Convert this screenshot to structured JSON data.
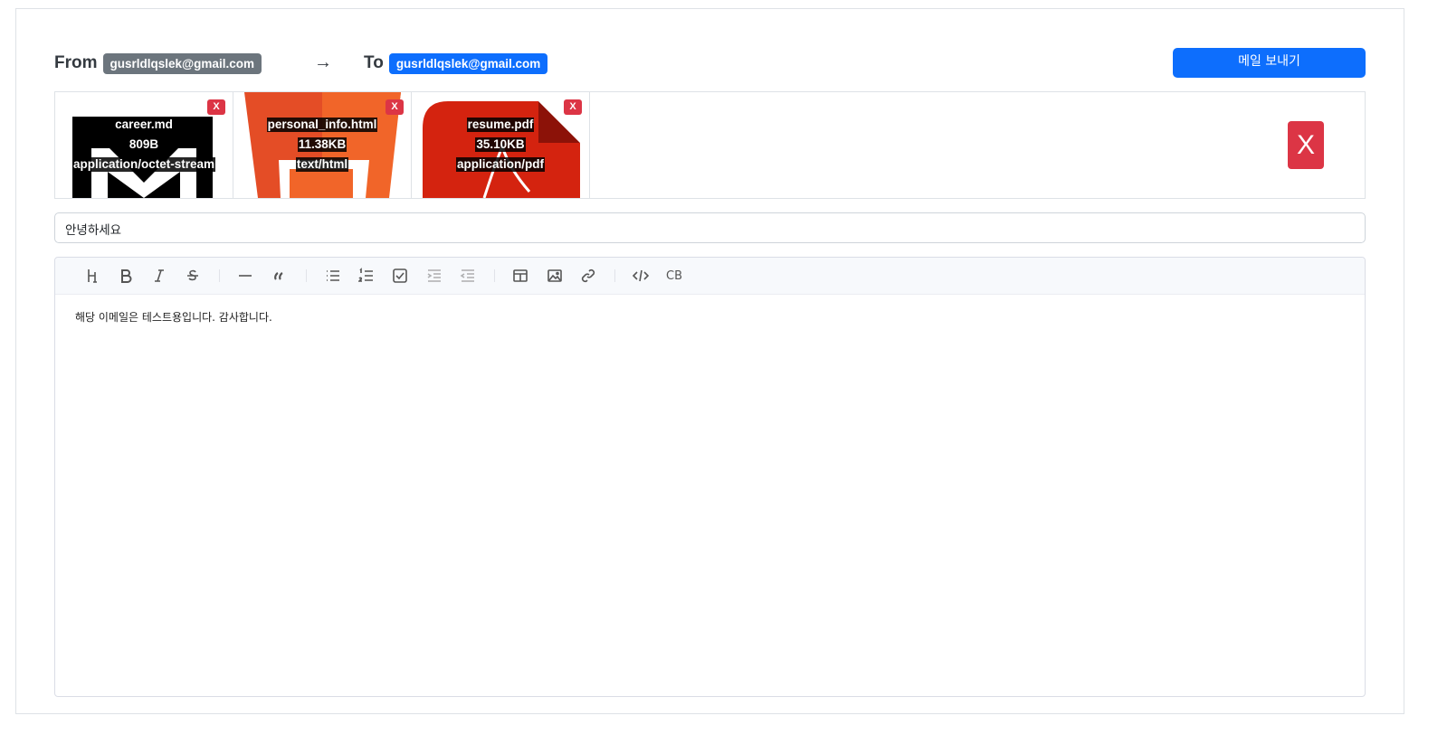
{
  "header": {
    "from_label": "From",
    "from_email": "gusrldlqslek@gmail.com",
    "arrow": "→",
    "to_label": "To",
    "to_email": "gusrldlqslek@gmail.com",
    "send_label": "메일 보내기"
  },
  "attachments": [
    {
      "name": "career.md",
      "size": "809B",
      "type": "application/octet-stream",
      "remove": "X",
      "icon": "markdown-icon"
    },
    {
      "name": "personal_info.html",
      "size": "11.38KB",
      "type": "text/html",
      "remove": "X",
      "icon": "html5-icon"
    },
    {
      "name": "resume.pdf",
      "size": "35.10KB",
      "type": "application/pdf",
      "remove": "X",
      "icon": "pdf-icon"
    }
  ],
  "clear_all_label": "X",
  "subject": {
    "value": "안녕하세요"
  },
  "editor": {
    "toolbar": [
      "heading-icon",
      "bold-icon",
      "italic-icon",
      "strike-icon",
      "hr-icon",
      "quote-icon",
      "bullet-list-icon",
      "ordered-list-icon",
      "task-list-icon",
      "indent-icon",
      "outdent-icon",
      "table-icon",
      "image-icon",
      "link-icon",
      "code-icon",
      "codeblock-icon"
    ],
    "codeblock_label": "CB",
    "content": "해당 이메일은 테스트용입니다. 감사합니다."
  },
  "colors": {
    "primary": "#0d6efd",
    "danger": "#dc3545",
    "secondary": "#6c757d"
  }
}
